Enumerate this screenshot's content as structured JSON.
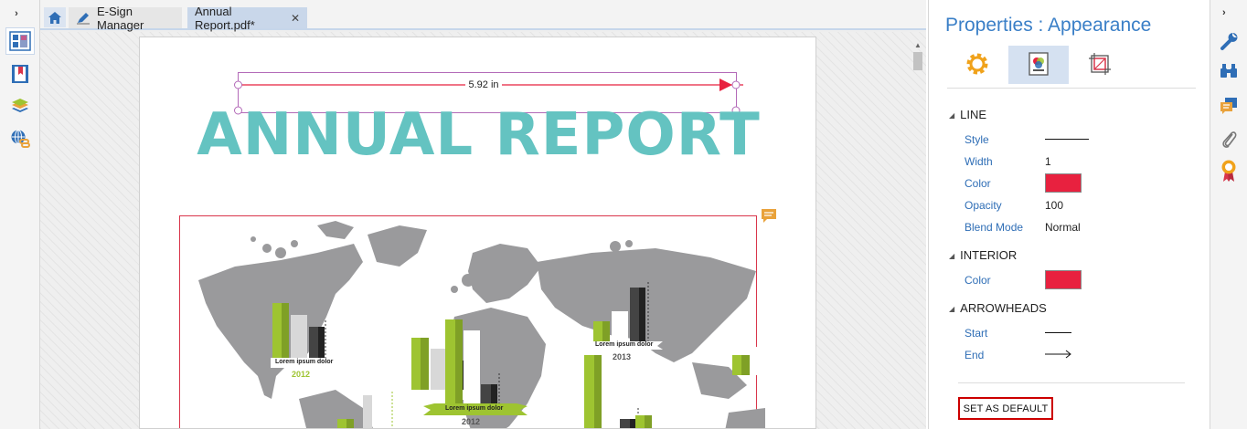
{
  "tabs": {
    "home_icon": "home-icon",
    "esign_label": "E-Sign Manager",
    "document_label": "Annual Report.pdf*",
    "close_glyph": "✕"
  },
  "left_rail": {
    "toggle": "›",
    "items": [
      "thumbnails-icon",
      "bookmarks-icon",
      "layers-icon",
      "links-icon"
    ]
  },
  "document": {
    "title": "ANNUAL REPORT",
    "measurement": "5.92 in",
    "chart_labels": {
      "america": "Lorem ipsum dolor",
      "america_year": "2012",
      "asia": "Lorem ipsum dolor",
      "asia_year": "2013",
      "africa": "Lorem ipsum dolor",
      "africa_year": "2012"
    }
  },
  "properties": {
    "title": "Properties : Appearance",
    "sections": {
      "line": "LINE",
      "interior": "INTERIOR",
      "arrowheads": "ARROWHEADS"
    },
    "line": {
      "style_label": "Style",
      "width_label": "Width",
      "width_value": "1",
      "color_label": "Color",
      "opacity_label": "Opacity",
      "opacity_value": "100",
      "blend_label": "Blend Mode",
      "blend_value": "Normal"
    },
    "interior": {
      "color_label": "Color"
    },
    "arrowheads": {
      "start_label": "Start",
      "end_label": "End"
    },
    "default_button": "SET AS DEFAULT"
  },
  "right_rail": {
    "toggle": "›",
    "items": [
      "wrench-icon",
      "binoculars-icon",
      "comments-icon",
      "attachment-icon",
      "certificate-icon"
    ]
  },
  "colors": {
    "accent": "#3a7fc7",
    "line_color": "#e8213f",
    "interior_color": "#e8213f",
    "title_teal": "#64c3c1",
    "map_gray": "#9a9a9c",
    "bar_green": "#9ec431"
  }
}
